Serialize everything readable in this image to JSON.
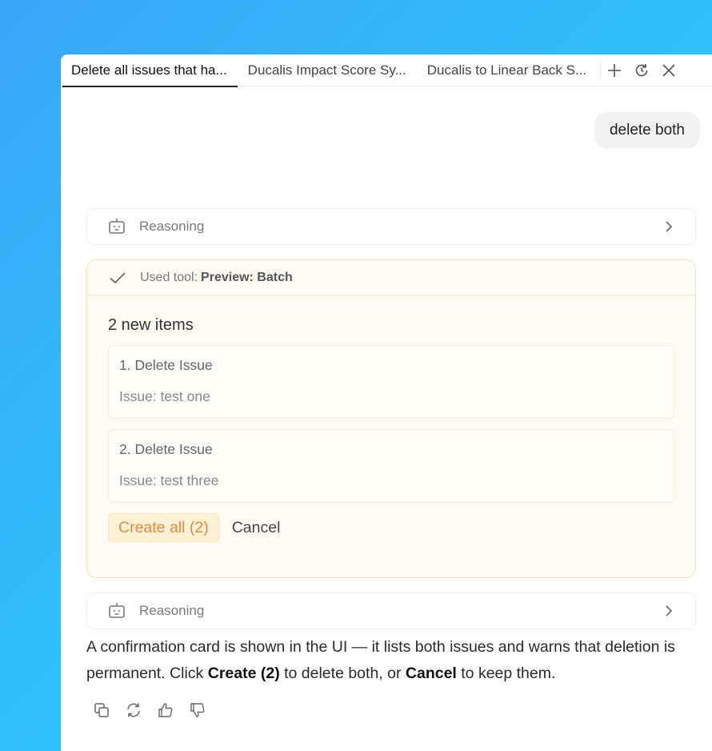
{
  "tabs": [
    {
      "label": "Delete all issues that ha...",
      "active": true
    },
    {
      "label": "Ducalis Impact Score Sy...",
      "active": false
    },
    {
      "label": "Ducalis to Linear Back S...",
      "active": false
    }
  ],
  "tab_actions": [
    "plus-icon",
    "history-icon",
    "close-icon"
  ],
  "user_message": "delete both",
  "reasoning_label": "Reasoning",
  "tool": {
    "prefix": "Used tool:",
    "name": "Preview: Batch",
    "heading": "2 new items",
    "items": [
      {
        "title": "1. Delete Issue",
        "sub": "Issue: test one"
      },
      {
        "title": "2. Delete Issue",
        "sub": "Issue: test three"
      }
    ],
    "create_label": "Create all (2)",
    "cancel_label": "Cancel"
  },
  "answer": {
    "line1": "A confirmation card is shown in the UI — it lists both issues and warns that deletion is permanent. Click ",
    "bold1": "Create (2)",
    "mid": " to delete both, or ",
    "bold2": "Cancel",
    "end": " to keep them."
  },
  "feedback_icons": [
    "copy-icon",
    "regenerate-icon",
    "thumbs-up-icon",
    "thumbs-down-icon"
  ],
  "colors": {
    "accent": "#e28a3c",
    "card_bg": "#fffcf5",
    "card_border": "#f5e3b8",
    "background_start": "#3aa6f6",
    "background_end": "#34cdfd"
  }
}
